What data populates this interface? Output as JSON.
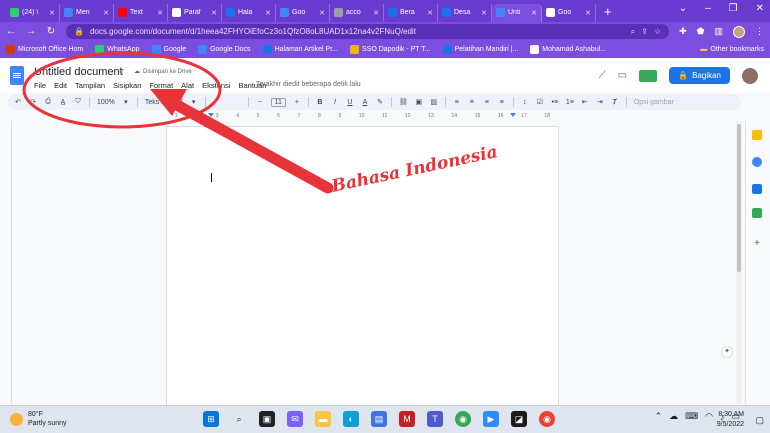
{
  "browser": {
    "tabs": [
      {
        "title": "(24) \\",
        "color": "#25d366"
      },
      {
        "title": "Men",
        "color": "#4285f4"
      },
      {
        "title": "Text",
        "color": "#ff0000"
      },
      {
        "title": "Paraf",
        "color": "#ffffff"
      },
      {
        "title": "Hala",
        "color": "#1a73e8"
      },
      {
        "title": "Goo",
        "color": "#4285f4"
      },
      {
        "title": "acco",
        "color": "#9aa0a6"
      },
      {
        "title": "Bera",
        "color": "#1a73e8"
      },
      {
        "title": "Desa",
        "color": "#1a73e8"
      },
      {
        "title": "Unti",
        "color": "#4285f4"
      },
      {
        "title": "Goo",
        "color": "#ffffff"
      }
    ],
    "new_tab": "+",
    "url": "docs.google.com/document/d/1heea42FHYOiEfoCz3o1QfzO8oL8UAD1x12na4v2FNuQ/edit",
    "bookmarks": [
      {
        "label": "Microsoft Office Hom",
        "color": "#d83b01"
      },
      {
        "label": "WhatsApp",
        "color": "#25d366"
      },
      {
        "label": "Google",
        "color": "#4285f4"
      },
      {
        "label": "Google Docs",
        "color": "#4285f4"
      },
      {
        "label": "Halaman Artikel Pr...",
        "color": "#1a73e8"
      },
      {
        "label": "SSO Dapodik - PT T...",
        "color": "#f4b400"
      },
      {
        "label": "Pelatihan Mandiri |...",
        "color": "#1a73e8"
      },
      {
        "label": "Mohamad Ashabul...",
        "color": "#ffffff"
      }
    ],
    "other_bookmarks": "Other bookmarks"
  },
  "docs": {
    "title": "Untitled document",
    "saved_status": "Disimpan ke Drive",
    "menu": [
      "File",
      "Edit",
      "Tampilan",
      "Sisipkan",
      "Format",
      "Alat",
      "Ekstensi",
      "Bantuan"
    ],
    "last_edit": "Terakhir diedit beberapa detik lalu",
    "share_label": "Bagikan",
    "toolbar": {
      "zoom": "100%",
      "style": "Teks normal",
      "font_size": "11",
      "minus": "−",
      "plus": "+",
      "image_options": "Opsi gambar"
    },
    "ruler_ticks": [
      "1",
      "2",
      "3",
      "4",
      "5",
      "6",
      "7",
      "8",
      "9",
      "10",
      "11",
      "12",
      "13",
      "14",
      "15",
      "16",
      "17",
      "18"
    ]
  },
  "annotation": {
    "label": "Bahasa Indonesia",
    "color": "#e8333a"
  },
  "taskbar": {
    "temperature": "80°F",
    "weather": "Partly sunny",
    "time": "8:30 AM",
    "date": "9/5/2022"
  }
}
